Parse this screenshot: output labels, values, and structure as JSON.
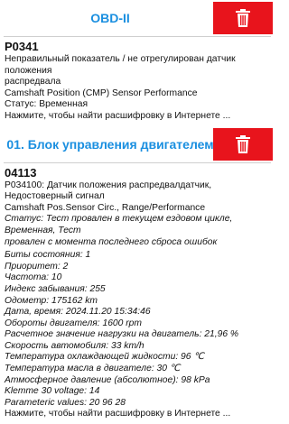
{
  "colors": {
    "accent": "#1a8fe0",
    "delete": "#e8141c"
  },
  "sections": [
    {
      "title": "OBD-II",
      "delete_icon": "trash-icon",
      "code": "P0341",
      "description_lines": [
        "Неправильный показатель / не отрегулирован датчик положения",
        "распредвала",
        "Camshaft Position (CMP) Sensor Performance"
      ],
      "status": "Статус: Временная",
      "link": "Нажмите, чтобы найти расшифровку в Интернете ..."
    },
    {
      "title": "01. Блок управления двигателем",
      "delete_icon": "trash-icon",
      "code": "04113",
      "description_lines": [
        "P034100: Датчик положения распредвалдатчик, Недостоверный сигнал",
        "Camshaft Pos.Sensor Circ., Range/Performance"
      ],
      "status_lines": [
        "Статус: Тест провален в текущем ездовом цикле, Временная, Тест",
        "провален с момента последнего сброса ошибок"
      ],
      "details": [
        "Биты состояния: 1",
        "Приоритет: 2",
        "Частота: 10",
        "Индекс забывания: 255",
        "Одометр: 175162 km",
        "Дата, время: 2024.11.20 15:34:46",
        "Обороты двигателя: 1600 rpm",
        "Расчетное значение нагрузки на двигатель: 21,96 %",
        "Скорость автомобиля: 33 km/h",
        "Температура охлаждающей жидкости: 96 ℃",
        "Температура масла в двигателе: 30 ℃",
        "Атмосферное давление (абсолютное): 98 kPa",
        "Klemme 30 voltage: 14",
        "Parameteric values:  20 96 28"
      ],
      "link": "Нажмите, чтобы найти расшифровку в Интернете ..."
    }
  ]
}
